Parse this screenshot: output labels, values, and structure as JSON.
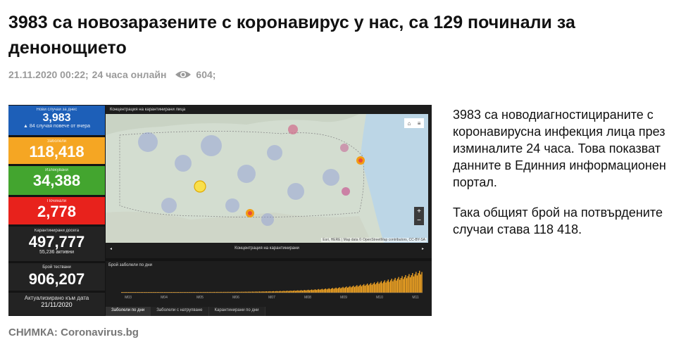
{
  "article": {
    "headline": "3983 са новозаразените с коронавирус у нас, са 129 починали за денонощието",
    "date": "21.11.2020 00:22;",
    "source": "24 часа онлайн",
    "views": "604;",
    "paragraphs": [
      "3983 са новодиагностицираните с коронавирусна инфекция лица през изминалите 24 часа. Това показват данните в Единния информационен портал.",
      "Така общият брой на потвърдените случаи става 118 418."
    ],
    "caption_label": "СНИМКА:",
    "caption_source": "Coronavirus.bg"
  },
  "dashboard": {
    "new_label": "Нови случаи за днес",
    "new_value": "3,983",
    "new_sub": "▲ 84 случая повече от вчера",
    "total_label": "Заболели",
    "total_value": "118,418",
    "recovered_label": "Излекувани",
    "recovered_value": "34,388",
    "deaths_label": "Починали",
    "deaths_value": "2,778",
    "quarantine_label": "Карантинирани досега",
    "quarantine_value": "497,777",
    "quarantine_sub": "55,236 активни",
    "tests_label": "Брой тествани",
    "tests_value": "906,207",
    "updated_label": "Актуализирано към дата",
    "updated_value": "21/11/2020",
    "map_title": "Концентрация на карантинирани лица",
    "map_footer": "Концентрация на карантинирани",
    "attribution": "Esri, HERE | Map data © OpenStreetMap contributors, CC-BY-SA",
    "chart_title": "Брой заболели по дни",
    "months": [
      "M03",
      "M04",
      "M05",
      "M06",
      "M07",
      "M08",
      "M09",
      "M10",
      "M11"
    ],
    "tabs": [
      "Заболели по дни",
      "Заболели с натрупване",
      "Карантинирани по дни"
    ],
    "colors": {
      "blue": "#1d5fb8",
      "orange": "#f5a623",
      "green": "#43a52f",
      "red": "#e8221c"
    }
  }
}
